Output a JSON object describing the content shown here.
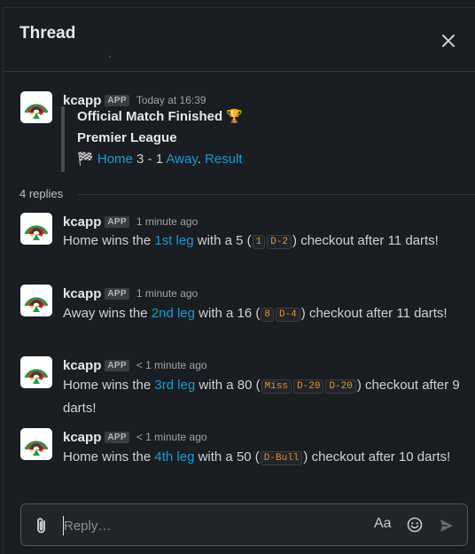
{
  "header": {
    "title": "Thread"
  },
  "parent": {
    "sender": "kcapp",
    "badge": "APP",
    "time": "Today at 16:39",
    "title": "Official Match Finished",
    "title_emoji": "🏆",
    "league": "Premier League",
    "flag_emoji": "🏁",
    "home": "Home",
    "score": "3 - 1",
    "away": "Away",
    "sep": ".",
    "result": "Result"
  },
  "replies_label": "4 replies",
  "replies": [
    {
      "sender": "kcapp",
      "badge": "APP",
      "time": "1 minute ago",
      "pre": "Home wins the ",
      "leg": "1st leg",
      "mid": " with a 5 (",
      "darts": [
        "1",
        "D-2"
      ],
      "post": ") checkout after 11 darts!"
    },
    {
      "sender": "kcapp",
      "badge": "APP",
      "time": "1 minute ago",
      "pre": "Away wins the ",
      "leg": "2nd leg",
      "mid": " with a 16 (",
      "darts": [
        "8",
        "D-4"
      ],
      "post": ") checkout after 11 darts!"
    },
    {
      "sender": "kcapp",
      "badge": "APP",
      "time": "< 1 minute ago",
      "pre": "Home wins the ",
      "leg": "3rd leg",
      "mid": " with a 80 (",
      "darts": [
        "Miss",
        "D-20",
        "D-20"
      ],
      "post": ") checkout after 9 darts!"
    },
    {
      "sender": "kcapp",
      "badge": "APP",
      "time": "< 1 minute ago",
      "pre": "Home wins the ",
      "leg": "4th leg",
      "mid": " with a 50 (",
      "darts": [
        "D-Bull"
      ],
      "post": ") checkout after 10 darts!"
    }
  ],
  "composer": {
    "placeholder": "Reply…",
    "format_label": "Aa"
  },
  "icons": {
    "close": "close-icon",
    "attach": "paperclip-icon",
    "emoji": "emoji-icon",
    "send": "send-icon",
    "avatar": "dartboard-logo"
  },
  "colors": {
    "link": "#1d9bd1",
    "code": "#e8912d",
    "background": "#1a1d21"
  }
}
